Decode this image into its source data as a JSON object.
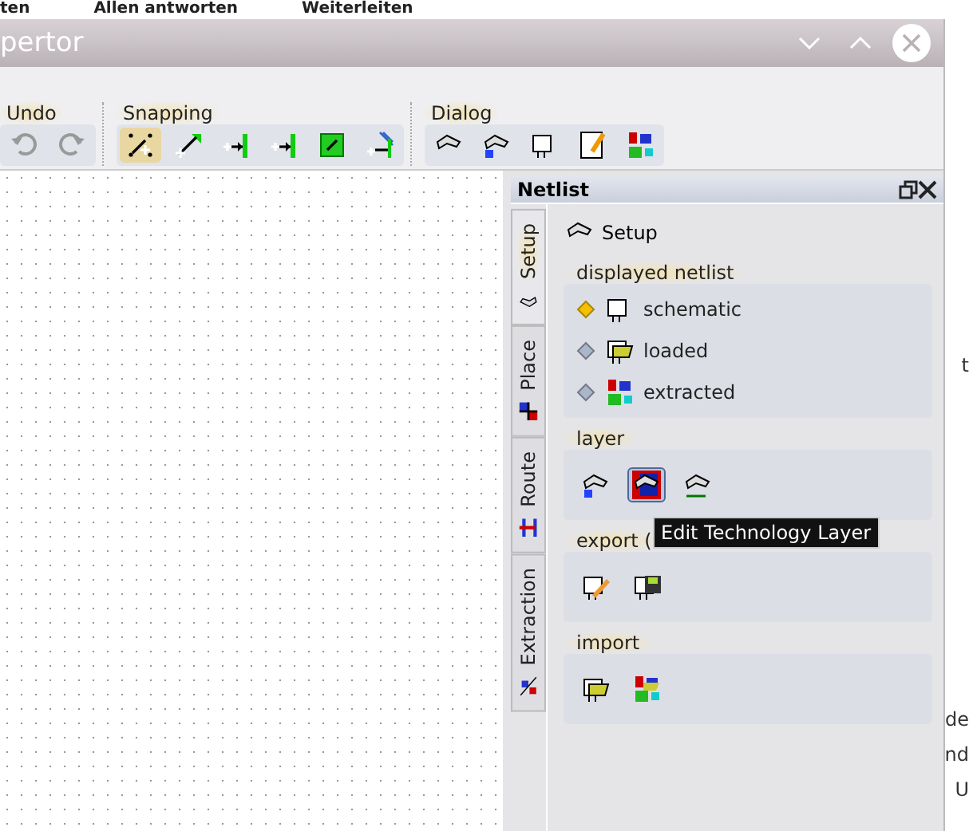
{
  "background_app": {
    "toolbar_items": [
      "ten",
      "Allen antworten",
      "Weiterleiten"
    ],
    "side_fragments": [
      "t",
      "de",
      "nd",
      "U"
    ]
  },
  "window": {
    "title": "pertor"
  },
  "toolbar": {
    "groups": [
      {
        "label": "Undo"
      },
      {
        "label": "Snapping"
      },
      {
        "label": "Dialog"
      }
    ]
  },
  "netlist_panel": {
    "title": "Netlist",
    "tabs": [
      {
        "label": "Setup",
        "selected": true
      },
      {
        "label": "Place",
        "selected": false
      },
      {
        "label": "Route",
        "selected": false
      },
      {
        "label": "Extraction",
        "selected": false
      }
    ],
    "heading": "Setup",
    "sections": [
      {
        "kind": "radio",
        "label": "displayed netlist",
        "options": [
          {
            "label": "schematic",
            "selected": true
          },
          {
            "label": "loaded",
            "selected": false
          },
          {
            "label": "extracted",
            "selected": false
          }
        ]
      },
      {
        "kind": "buttons",
        "label": "layer",
        "buttons": [
          {
            "selected": false
          },
          {
            "selected": true
          },
          {
            "selected": false
          }
        ]
      },
      {
        "kind": "buttons",
        "label": "export (",
        "buttons": [
          {
            "selected": false
          },
          {
            "selected": false
          }
        ]
      },
      {
        "kind": "buttons",
        "label": "import",
        "buttons": [
          {
            "selected": false
          },
          {
            "selected": false
          }
        ]
      }
    ]
  },
  "tooltip": {
    "text": "Edit Technology Layer"
  }
}
